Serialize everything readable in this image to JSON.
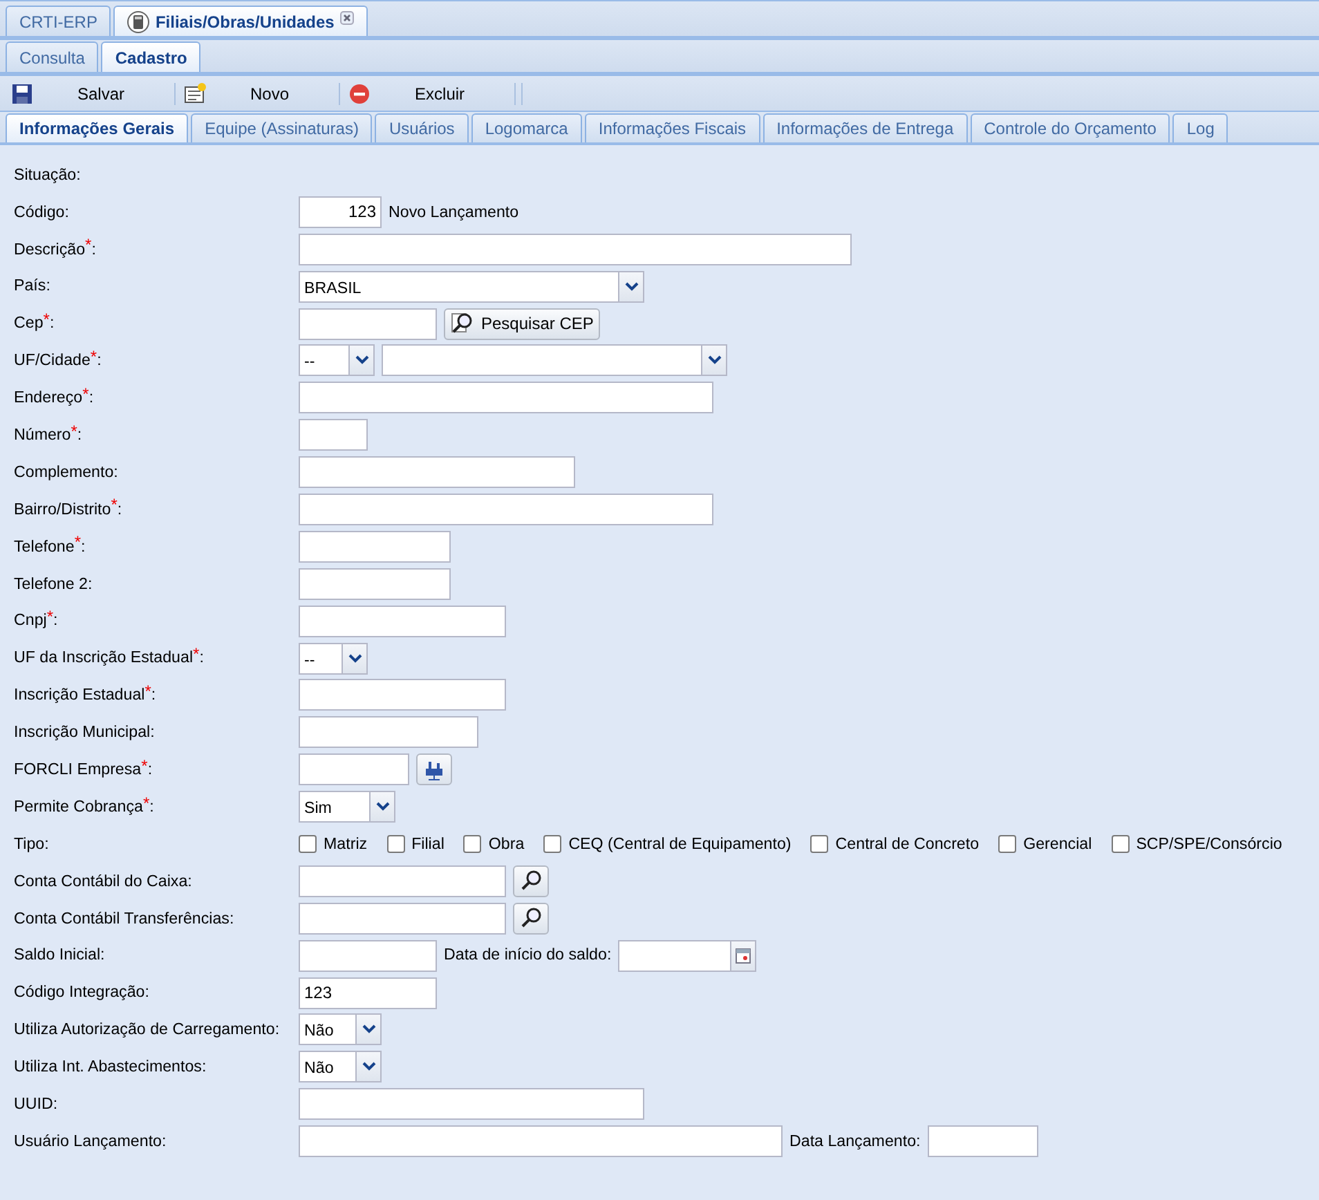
{
  "app_tabs": [
    {
      "label": "CRTI-ERP",
      "selected": false,
      "closable": false
    },
    {
      "label": "Filiais/Obras/Unidades",
      "selected": true,
      "closable": true
    }
  ],
  "mode_tabs": [
    {
      "label": "Consulta",
      "selected": false
    },
    {
      "label": "Cadastro",
      "selected": true
    }
  ],
  "toolbar": [
    {
      "label": "Salvar",
      "kind": "save"
    },
    {
      "label": "Novo",
      "kind": "new"
    },
    {
      "label": "Excluir",
      "kind": "delete"
    }
  ],
  "section_tabs": [
    {
      "label": "Informações Gerais",
      "selected": true
    },
    {
      "label": "Equipe (Assinaturas)",
      "selected": false
    },
    {
      "label": "Usuários",
      "selected": false
    },
    {
      "label": "Logomarca",
      "selected": false
    },
    {
      "label": "Informações Fiscais",
      "selected": false
    },
    {
      "label": "Informações de Entrega",
      "selected": false
    },
    {
      "label": "Controle do Orçamento",
      "selected": false
    },
    {
      "label": "Log",
      "selected": false
    }
  ],
  "form": [
    {
      "label": "Situação:"
    },
    {
      "label": "Código:",
      "controls": [
        {
          "kind": "number",
          "value": "123"
        },
        {
          "kind": "text",
          "text": "Novo Lançamento"
        }
      ]
    },
    {
      "label": "Descrição$^{*}$:",
      "controls": [
        {
          "kind": "input"
        }
      ]
    },
    {
      "label": "País:",
      "controls": [
        {
          "kind": "select",
          "value": "BRASIL"
        }
      ]
    },
    {
      "label": "Cep$^{*}$:",
      "controls": [
        {
          "kind": "input"
        },
        {
          "kind": "button",
          "text": "Pesquisar CEP"
        }
      ]
    },
    {
      "label": "UF/Cidade$^{*}$:",
      "controls": [
        {
          "kind": "select",
          "value": "--"
        },
        {
          "kind": "select"
        }
      ]
    },
    {
      "label": "Endereço$^{*}$:",
      "controls": [
        {
          "kind": "input"
        }
      ]
    },
    {
      "label": "Número$^{*}$:",
      "controls": [
        {
          "kind": "input"
        }
      ]
    },
    {
      "label": "Complemento:",
      "controls": [
        {
          "kind": "input"
        }
      ]
    },
    {
      "label": "Bairro/Distrito$^{*}$:",
      "controls": [
        {
          "kind": "input"
        }
      ]
    },
    {
      "label": "Telefone$^{*}$:",
      "controls": [
        {
          "kind": "input"
        }
      ]
    },
    {
      "label": "Telefone 2:",
      "controls": [
        {
          "kind": "input"
        }
      ]
    },
    {
      "label": "Cnpj$^{*}$:",
      "controls": [
        {
          "kind": "input"
        }
      ]
    },
    {
      "label": "UF da Inscrição Estadual$^{*}$:",
      "controls": [
        {
          "kind": "select",
          "value": "--"
        }
      ]
    },
    {
      "label": "Inscrição Estadual$^{*}$:",
      "controls": [
        {
          "kind": "input"
        }
      ]
    },
    {
      "label": "Inscrição Municipal:",
      "controls": [
        {
          "kind": "input"
        }
      ]
    },
    {
      "label": "FORCLI Empresa$^{*}$:",
      "controls": [
        {
          "kind": "input"
        },
        {
          "kind": "factory"
        }
      ]
    },
    {
      "label": "Permite Cobrança$^{*}$:",
      "controls": [
        {
          "kind": "select",
          "value": "Sim"
        }
      ]
    },
    {
      "label": "Tipo:",
      "controls": [
        {
          "kind": "checkbox",
          "text": "Matriz",
          "checked": false
        },
        {
          "kind": "checkbox",
          "text": "Filial",
          "checked": false
        },
        {
          "kind": "checkbox",
          "text": "Obra",
          "checked": false
        },
        {
          "kind": "checkbox",
          "text": "CEQ (Central de Equipamento)",
          "checked": false
        },
        {
          "kind": "checkbox",
          "text": "Central de Concreto",
          "checked": false
        },
        {
          "kind": "checkbox",
          "text": "Gerencial",
          "checked": false
        },
        {
          "kind": "checkbox",
          "text": "SCP/SPE/Consórcio",
          "checked": false
        }
      ]
    },
    {
      "label": "Conta Contábil do Caixa:",
      "controls": [
        {
          "kind": "input"
        },
        {
          "kind": "search"
        }
      ]
    },
    {
      "label": "Conta Contábil Transferências:",
      "controls": [
        {
          "kind": "input"
        },
        {
          "kind": "search"
        }
      ]
    },
    {
      "label": "Saldo Inicial:",
      "controls": [
        {
          "kind": "input"
        },
        {
          "kind": "text",
          "text": "Data de início do saldo:"
        },
        {
          "kind": "date"
        }
      ]
    },
    {
      "label": "Código Integração:",
      "controls": [
        {
          "kind": "input",
          "value": "123"
        }
      ]
    },
    {
      "label": "Utiliza Autorização de Carregamento:",
      "controls": [
        {
          "kind": "select",
          "value": "Não"
        }
      ]
    },
    {
      "label": "Utiliza Int. Abastecimentos:",
      "controls": [
        {
          "kind": "select",
          "value": "Não"
        }
      ]
    },
    {
      "label": "UUID:",
      "controls": [
        {
          "kind": "input"
        }
      ]
    },
    {
      "label": "Usuário Lançamento:",
      "controls": [
        {
          "kind": "input"
        },
        {
          "kind": "text",
          "text": "Data Lançamento:"
        },
        {
          "kind": "input"
        }
      ]
    }
  ]
}
